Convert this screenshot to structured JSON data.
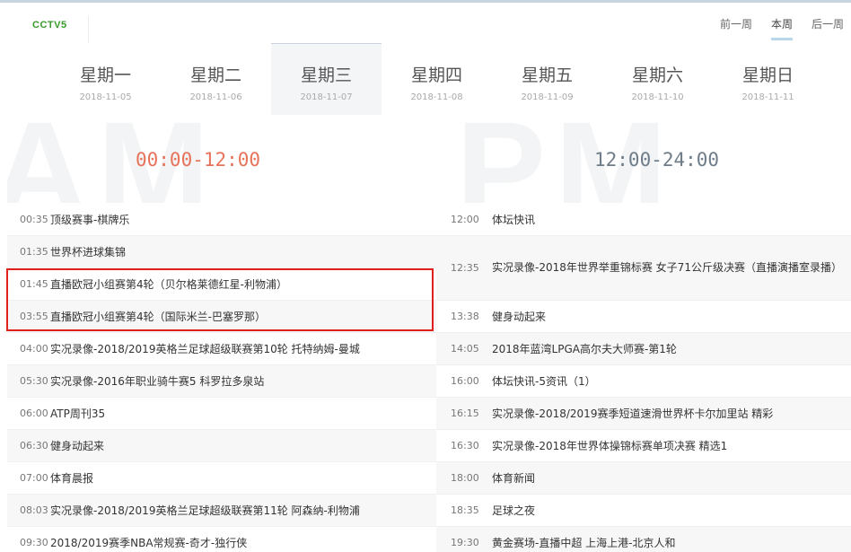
{
  "brand": {
    "logo": "CCTV5"
  },
  "week_nav": [
    "前一周",
    "本周",
    "后一周"
  ],
  "days": [
    {
      "name": "星期一",
      "date": "2018-11-05"
    },
    {
      "name": "星期二",
      "date": "2018-11-06"
    },
    {
      "name": "星期三",
      "date": "2018-11-07"
    },
    {
      "name": "星期四",
      "date": "2018-11-08"
    },
    {
      "name": "星期五",
      "date": "2018-11-09"
    },
    {
      "name": "星期六",
      "date": "2018-11-10"
    },
    {
      "name": "星期日",
      "date": "2018-11-11"
    }
  ],
  "periods": {
    "am_watermark": "AM",
    "pm_watermark": "PM",
    "am": "00:00-12:00",
    "pm": "12:00-24:00"
  },
  "am_programs": [
    {
      "time": "00:35",
      "title": "顶级赛事-棋牌乐"
    },
    {
      "time": "01:35",
      "title": "世界杯进球集锦"
    },
    {
      "time": "01:45",
      "title": "直播欧冠小组赛第4轮（贝尔格莱德红星-利物浦）"
    },
    {
      "time": "03:55",
      "title": "直播欧冠小组赛第4轮（国际米兰-巴塞罗那）"
    },
    {
      "time": "04:00",
      "title": "实况录像-2018/2019英格兰足球超级联赛第10轮 托特纳姆-曼城"
    },
    {
      "time": "05:30",
      "title": "实况录像-2016年职业骑牛赛5 科罗拉多泉站"
    },
    {
      "time": "06:00",
      "title": "ATP周刊35"
    },
    {
      "time": "06:30",
      "title": "健身动起来"
    },
    {
      "time": "07:00",
      "title": "体育晨报"
    },
    {
      "time": "08:03",
      "title": "实况录像-2018/2019英格兰足球超级联赛第11轮 阿森纳-利物浦"
    },
    {
      "time": "09:30",
      "title": "2018/2019赛季NBA常规赛-奇才-独行侠"
    }
  ],
  "pm_programs": [
    {
      "time": "12:00",
      "title": "体坛快讯"
    },
    {
      "time": "12:35",
      "title": "实况录像-2018年世界举重锦标赛 女子71公斤级决赛（直播演播室录播）"
    },
    {
      "time": "13:38",
      "title": "健身动起来"
    },
    {
      "time": "14:05",
      "title": "2018年蓝湾LPGA高尔夫大师赛-第1轮"
    },
    {
      "time": "16:00",
      "title": "体坛快讯-5资讯（1）"
    },
    {
      "time": "16:15",
      "title": "实况录像-2018/2019赛季短道速滑世界杯卡尔加里站 精彩"
    },
    {
      "time": "16:30",
      "title": "实况录像-2018年世界体操锦标赛单项决赛 精选1"
    },
    {
      "time": "18:00",
      "title": "体育新闻"
    },
    {
      "time": "18:35",
      "title": "足球之夜"
    },
    {
      "time": "19:30",
      "title": "黄金赛场-直播中超 上海上港-北京人和"
    }
  ]
}
